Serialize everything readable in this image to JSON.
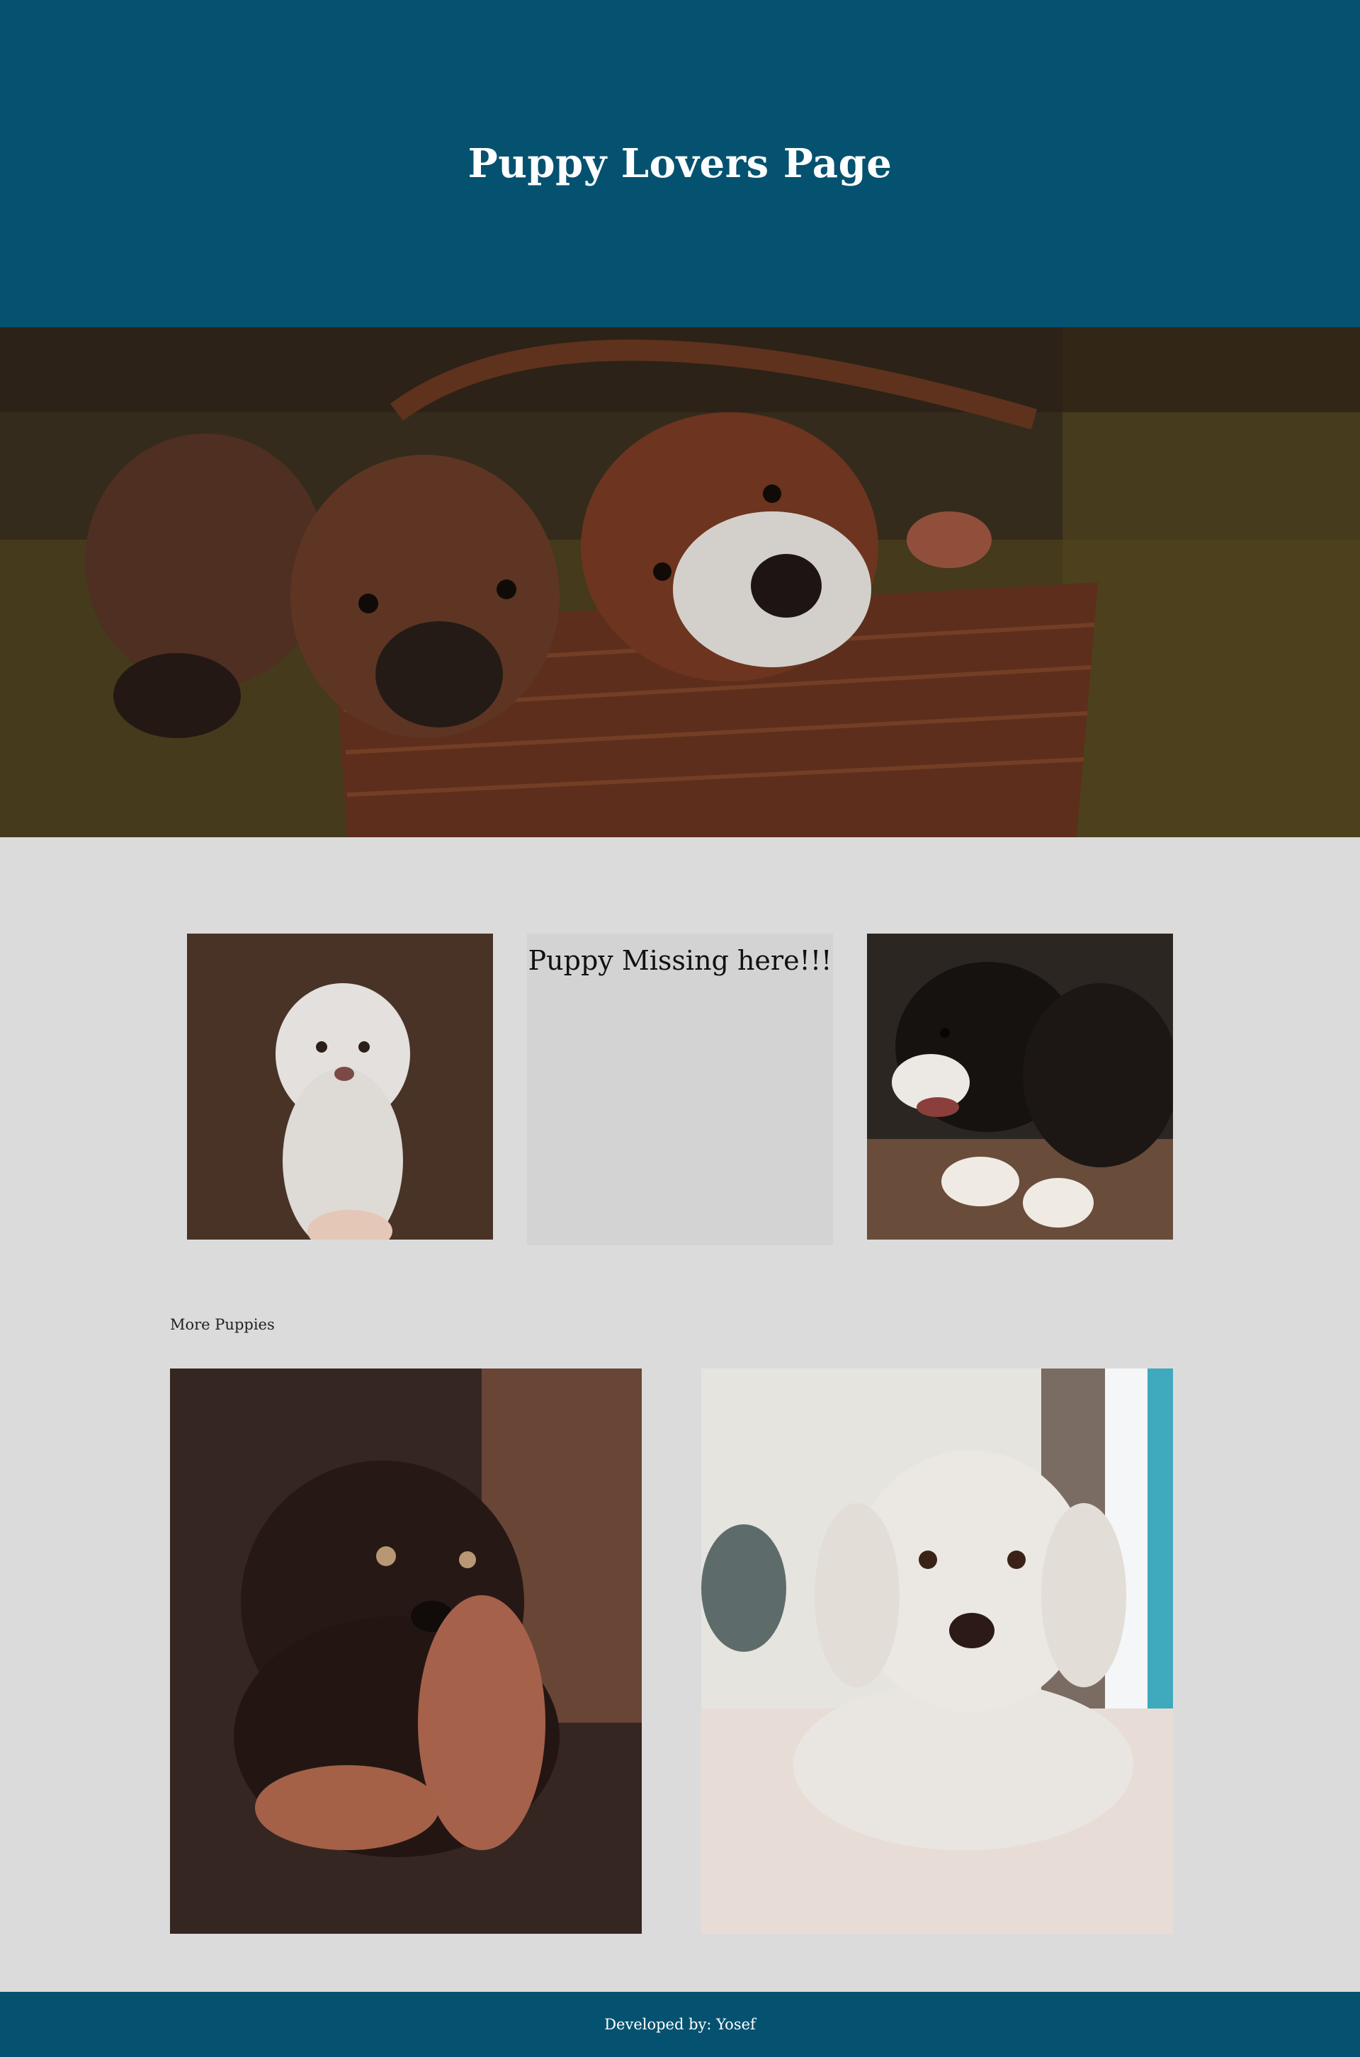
{
  "header": {
    "title": "Puppy Lovers Page"
  },
  "gallery": {
    "missing_text": "Puppy Missing here!!!"
  },
  "more_section": {
    "label": "More Puppies"
  },
  "footer": {
    "credit": "Developed by: Yosef"
  },
  "colors": {
    "header_bg": "#055270",
    "page_bg": "#dcdbdb",
    "missing_tile_bg": "#d3d3d3",
    "footer_bg": "#055270"
  }
}
